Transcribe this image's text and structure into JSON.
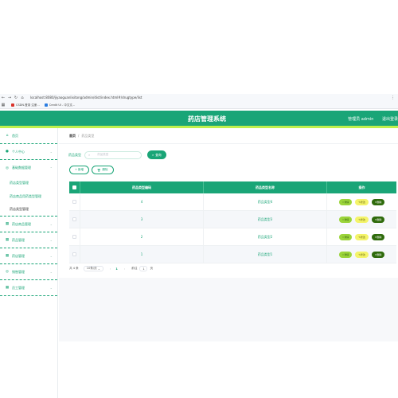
{
  "browser": {
    "url": "localhost:8080/jiyaoguanlixitong/admin/dist/index.html#/drugtype/list",
    "bookmarks": [
      "CSDN-登录 注册...",
      "Credit UI - 中文文..."
    ],
    "colors": {
      "favicon": "#2a7de1",
      "favicon_alt": "#d9332b"
    }
  },
  "header": {
    "title": "药店管理系统",
    "user_label": "管理员 admin",
    "logout_label": "退出登录",
    "colors": {
      "primary": "#1aa577",
      "accent": "#bff04c"
    }
  },
  "sidebar": {
    "items": [
      {
        "label": "首页",
        "icon": "home-icon"
      },
      {
        "label": "个人中心",
        "icon": "user-icon",
        "expandable": true
      },
      {
        "label": "基础数据管理",
        "icon": "gear-icon",
        "expandable": true
      }
    ],
    "subitems": [
      {
        "label": "药店类型管理"
      },
      {
        "label": "药店商品用药类型管理"
      },
      {
        "label": "药店类型管理",
        "active": true
      }
    ],
    "items2": [
      {
        "label": "药店商品管理",
        "icon": "grid-icon"
      },
      {
        "label": "药品管理",
        "icon": "grid-icon"
      },
      {
        "label": "药店管理",
        "icon": "grid-icon"
      },
      {
        "label": "销售管理",
        "icon": "gear-icon"
      },
      {
        "label": "员工管理",
        "icon": "grid-icon"
      }
    ]
  },
  "breadcrumb": {
    "home": "首页",
    "separator": "/",
    "current": "药品类型"
  },
  "search": {
    "label": "药品类型",
    "placeholder": "药品类型",
    "button": "查询"
  },
  "actions": {
    "add": "+ 新增",
    "delete": "删除"
  },
  "table": {
    "columns": [
      "药品类型编码",
      "药品类型名称",
      "操作"
    ],
    "rows": [
      {
        "code": "4",
        "name": "药品类型4"
      },
      {
        "code": "3",
        "name": "药品类型3"
      },
      {
        "code": "2",
        "name": "药品类型2"
      },
      {
        "code": "1",
        "name": "药品类型1"
      }
    ],
    "ops": {
      "detail": "详情",
      "edit": "修改",
      "delete": "删除"
    },
    "colors": {
      "detail": "#9bd43a",
      "edit": "#f4f46a",
      "delete": "#2f6b0c"
    }
  },
  "pagination": {
    "total": "共 4 条",
    "page_size": "10条/页",
    "current_page": "1",
    "goto_label": "前往",
    "goto_value": "1",
    "page_suffix": "页"
  }
}
